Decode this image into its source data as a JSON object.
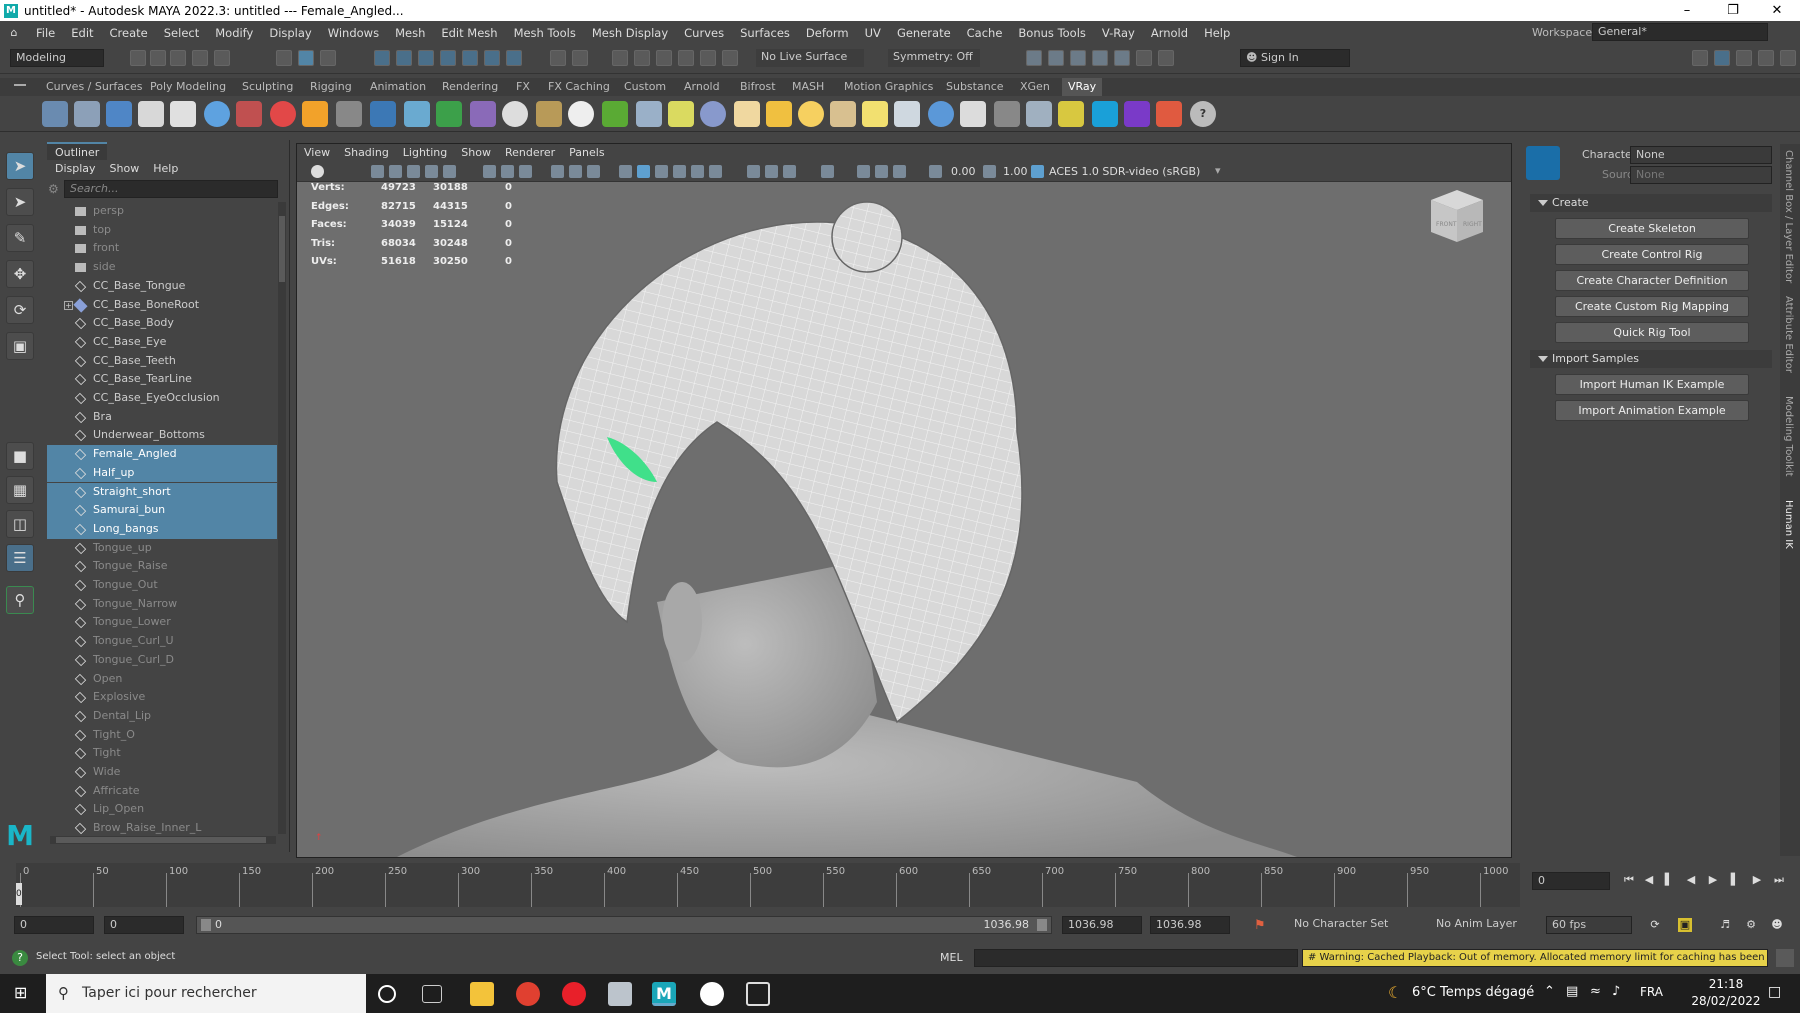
{
  "titlebar": {
    "title": "untitled* - Autodesk MAYA 2022.3: untitled   ---   Female_Angled..."
  },
  "menubar": {
    "items": [
      "File",
      "Edit",
      "Create",
      "Select",
      "Modify",
      "Display",
      "Windows",
      "Mesh",
      "Edit Mesh",
      "Mesh Tools",
      "Mesh Display",
      "Curves",
      "Surfaces",
      "Deform",
      "UV",
      "Generate",
      "Cache",
      "Bonus Tools",
      "V-Ray",
      "Arnold",
      "Help"
    ],
    "workspace_label": "Workspace:",
    "workspace_value": "General*"
  },
  "statusline": {
    "mode": "Modeling",
    "live_surface": "No Live Surface",
    "symmetry": "Symmetry: Off",
    "sign_in": "Sign In"
  },
  "shelf_tabs": [
    "Curves / Surfaces",
    "Poly Modeling",
    "Sculpting",
    "Rigging",
    "Animation",
    "Rendering",
    "FX",
    "FX Caching",
    "Custom",
    "Arnold",
    "Bifrost",
    "MASH",
    "Motion Graphics",
    "Substance",
    "XGen",
    "VRay"
  ],
  "shelf_active": "VRay",
  "outliner": {
    "title": "Outliner",
    "menu": [
      "Display",
      "Show",
      "Help"
    ],
    "search_placeholder": "Search...",
    "items": [
      {
        "label": "persp",
        "type": "camera",
        "dim": true
      },
      {
        "label": "top",
        "type": "camera",
        "dim": true
      },
      {
        "label": "front",
        "type": "camera",
        "dim": true
      },
      {
        "label": "side",
        "type": "camera",
        "dim": true
      },
      {
        "label": "CC_Base_Tongue",
        "type": "mesh"
      },
      {
        "label": "CC_Base_BoneRoot",
        "type": "joint",
        "expand": true
      },
      {
        "label": "CC_Base_Body",
        "type": "mesh"
      },
      {
        "label": "CC_Base_Eye",
        "type": "mesh"
      },
      {
        "label": "CC_Base_Teeth",
        "type": "mesh"
      },
      {
        "label": "CC_Base_TearLine",
        "type": "mesh"
      },
      {
        "label": "CC_Base_EyeOcclusion",
        "type": "mesh"
      },
      {
        "label": "Bra",
        "type": "mesh"
      },
      {
        "label": "Underwear_Bottoms",
        "type": "mesh"
      },
      {
        "label": "Female_Angled",
        "type": "mesh",
        "selected": true
      },
      {
        "label": "Half_up",
        "type": "mesh",
        "selected": true
      },
      {
        "label": "Straight_short",
        "type": "mesh",
        "selected": true
      },
      {
        "label": "Samurai_bun",
        "type": "mesh",
        "selected": true
      },
      {
        "label": "Long_bangs",
        "type": "mesh",
        "selected": true
      },
      {
        "label": "Tongue_up",
        "type": "mesh",
        "dim": true
      },
      {
        "label": "Tongue_Raise",
        "type": "mesh",
        "dim": true
      },
      {
        "label": "Tongue_Out",
        "type": "mesh",
        "dim": true
      },
      {
        "label": "Tongue_Narrow",
        "type": "mesh",
        "dim": true
      },
      {
        "label": "Tongue_Lower",
        "type": "mesh",
        "dim": true
      },
      {
        "label": "Tongue_Curl_U",
        "type": "mesh",
        "dim": true
      },
      {
        "label": "Tongue_Curl_D",
        "type": "mesh",
        "dim": true
      },
      {
        "label": "Open",
        "type": "mesh",
        "dim": true
      },
      {
        "label": "Explosive",
        "type": "mesh",
        "dim": true
      },
      {
        "label": "Dental_Lip",
        "type": "mesh",
        "dim": true
      },
      {
        "label": "Tight_O",
        "type": "mesh",
        "dim": true
      },
      {
        "label": "Tight",
        "type": "mesh",
        "dim": true
      },
      {
        "label": "Wide",
        "type": "mesh",
        "dim": true
      },
      {
        "label": "Affricate",
        "type": "mesh",
        "dim": true
      },
      {
        "label": "Lip_Open",
        "type": "mesh",
        "dim": true
      },
      {
        "label": "Brow_Raise_Inner_L",
        "type": "mesh",
        "dim": true
      }
    ]
  },
  "viewport": {
    "menu": [
      "View",
      "Shading",
      "Lighting",
      "Show",
      "Renderer",
      "Panels"
    ],
    "exposure": "0.00",
    "gamma": "1.00",
    "color_space": "ACES 1.0 SDR-video (sRGB)",
    "hud": [
      {
        "label": "Verts:",
        "a": "49723",
        "b": "30188",
        "c": "0"
      },
      {
        "label": "Edges:",
        "a": "82715",
        "b": "44315",
        "c": "0"
      },
      {
        "label": "Faces:",
        "a": "34039",
        "b": "15124",
        "c": "0"
      },
      {
        "label": "Tris:",
        "a": "68034",
        "b": "30248",
        "c": "0"
      },
      {
        "label": "UVs:",
        "a": "51618",
        "b": "30250",
        "c": "0"
      }
    ],
    "viewcube": {
      "front": "FRONT",
      "right": "RIGHT"
    }
  },
  "hik": {
    "character_label": "Character:",
    "character_value": "None",
    "source_label": "Source:",
    "source_value": "None",
    "create_section": "Create",
    "create_buttons": [
      "Create Skeleton",
      "Create Control Rig",
      "Create Character Definition",
      "Create Custom Rig Mapping",
      "Quick Rig Tool"
    ],
    "import_section": "Import Samples",
    "import_buttons": [
      "Import Human IK Example",
      "Import Animation Example"
    ]
  },
  "side_tabs": [
    "Channel Box / Layer Editor",
    "Attribute Editor",
    "Modeling Toolkit",
    "Human IK"
  ],
  "timeline": {
    "ticks": [
      "0",
      "50",
      "100",
      "150",
      "200",
      "250",
      "300",
      "350",
      "400",
      "450",
      "500",
      "550",
      "600",
      "650",
      "700",
      "750",
      "800",
      "850",
      "900",
      "950",
      "1000"
    ],
    "current_marker": "0",
    "current_frame": "0"
  },
  "range": {
    "start": "0",
    "start2": "0",
    "slider_start": "0",
    "slider_end": "1036.98",
    "end": "1036.98",
    "end2": "1036.98",
    "character_set": "No Character Set",
    "anim_layer": "No Anim Layer",
    "fps": "60 fps"
  },
  "cmdline": {
    "status": "Select Tool: select an object",
    "mel": "MEL",
    "warning": "# Warning: Cached Playback: Out of memory. Allocated memory limit for caching has been reach"
  },
  "taskbar": {
    "search": "Taper ici pour rechercher",
    "weather": "6°C  Temps dégagé",
    "lang": "FRA",
    "time": "21:18",
    "date": "28/02/2022"
  }
}
